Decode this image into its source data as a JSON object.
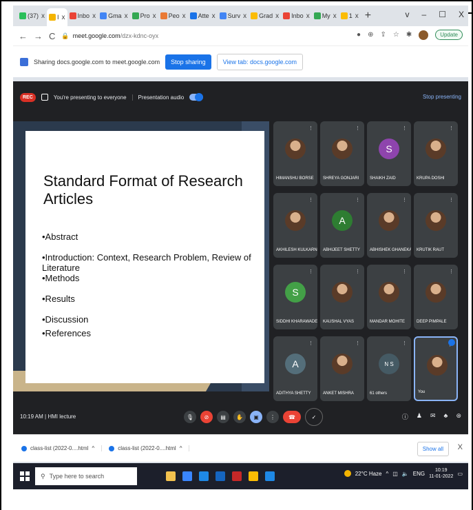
{
  "browser": {
    "tabs": [
      {
        "label": "(37)",
        "color": "#2bbf5a"
      },
      {
        "label": "I",
        "color": "#f4b400",
        "active": true
      },
      {
        "label": "Inbo",
        "color": "#ea4335"
      },
      {
        "label": "Gma",
        "color": "#4285f4"
      },
      {
        "label": "Pro",
        "color": "#34a853"
      },
      {
        "label": "Peo",
        "color": "#ea7a35"
      },
      {
        "label": "Atte",
        "color": "#1a73e8"
      },
      {
        "label": "Surv",
        "color": "#4285f4"
      },
      {
        "label": "Grad",
        "color": "#fbbc04"
      },
      {
        "label": "Inbo",
        "color": "#ea4335"
      },
      {
        "label": "My",
        "color": "#34a853"
      },
      {
        "label": "1",
        "color": "#fbbc04"
      }
    ],
    "new_tab": "+",
    "window_controls": [
      "v",
      "–",
      "☐",
      "X"
    ],
    "url_host": "meet.google.com",
    "url_path": "/dzx-kdnc-oyx",
    "update_label": "Update"
  },
  "sharebar": {
    "text": "Sharing docs.google.com to meet.google.com",
    "stop_label": "Stop sharing",
    "view_label": "View tab: docs.google.com"
  },
  "meet": {
    "rec": "REC",
    "presenting_text": "You're presenting to everyone",
    "audio_text": "Presentation audio",
    "stop_presenting": "Stop presenting",
    "time": "10:19 AM",
    "meeting_name": "HMI lecture"
  },
  "slide": {
    "title": "Standard Format of Research Articles",
    "bullets": [
      "•Abstract",
      "•Introduction: Context, Research Problem, Review of Literature",
      "•Methods",
      "•Results",
      "•Discussion",
      "•References"
    ]
  },
  "participants": [
    {
      "name": "HIMANSHU BORSE",
      "avatar": "pic"
    },
    {
      "name": "SHREYA GONJARI",
      "avatar": "pic"
    },
    {
      "name": "SHAIKH ZAID",
      "avatar": "S",
      "color": "#8e44ad"
    },
    {
      "name": "KRUPA DOSHI",
      "avatar": "pic"
    },
    {
      "name": "AKHILESH KULKARNI",
      "avatar": "pic"
    },
    {
      "name": "ABHIJEET SHETTY",
      "avatar": "A",
      "color": "#2e7d32"
    },
    {
      "name": "ABHISHEK GHANEKAR",
      "avatar": "pic"
    },
    {
      "name": "KRUTIK RAUT",
      "avatar": "pic"
    },
    {
      "name": "SIDDHI KHARAWADE",
      "avatar": "S",
      "color": "#43a047"
    },
    {
      "name": "KAUSHAL VYAS",
      "avatar": "pic"
    },
    {
      "name": "MANDAR MOHITE",
      "avatar": "pic"
    },
    {
      "name": "DEEP PIMPALE",
      "avatar": "pic"
    },
    {
      "name": "ADITHYA SHETTY",
      "avatar": "A",
      "color": "#546e7a"
    },
    {
      "name": "ANKET MISHRA",
      "avatar": "pic"
    },
    {
      "name": "61 others",
      "avatar": "N S",
      "color": "#455a64"
    },
    {
      "name": "You",
      "avatar": "pic",
      "you": true
    }
  ],
  "downloads": [
    {
      "label": "class-list (2022-0....html"
    },
    {
      "label": "class-list (2022-0....html"
    }
  ],
  "downloads_show_all": "Show all",
  "downloads_close": "X",
  "taskbar": {
    "search_placeholder": "Type here to search",
    "weather": "22°C Haze",
    "lang": "ENG",
    "time": "10:19",
    "date": "11-01-2022"
  }
}
